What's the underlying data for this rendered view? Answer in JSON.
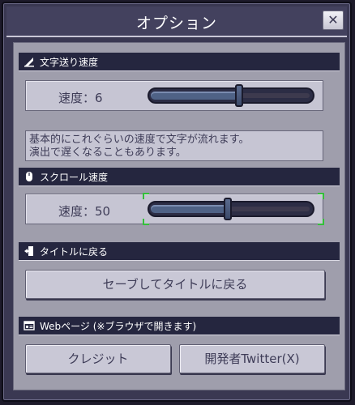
{
  "window": {
    "title": "オプション",
    "close_label": "✕"
  },
  "text_speed": {
    "header": "文字送り速度",
    "label": "速度：6",
    "value": 6,
    "fraction": 0.6,
    "description_line1": "基本的にこれぐらいの速度で文字が流れます。",
    "description_line2": "演出で遅くなることもあります。"
  },
  "scroll_speed": {
    "header": "スクロール速度",
    "label": "速度：50",
    "value": 50,
    "fraction": 0.5
  },
  "return_title": {
    "header": "タイトルに戻る",
    "button_label": "セーブしてタイトルに戻る"
  },
  "web_page": {
    "header": "Webページ (※ブラウザで開きます)",
    "credit_label": "クレジット",
    "twitter_label": "開発者Twitter(X)"
  },
  "colors": {
    "header_bg": "#25263f",
    "panel_bg": "#9f9eac",
    "slider_fill": "#4f6286",
    "focus_corner": "#34c03a"
  }
}
